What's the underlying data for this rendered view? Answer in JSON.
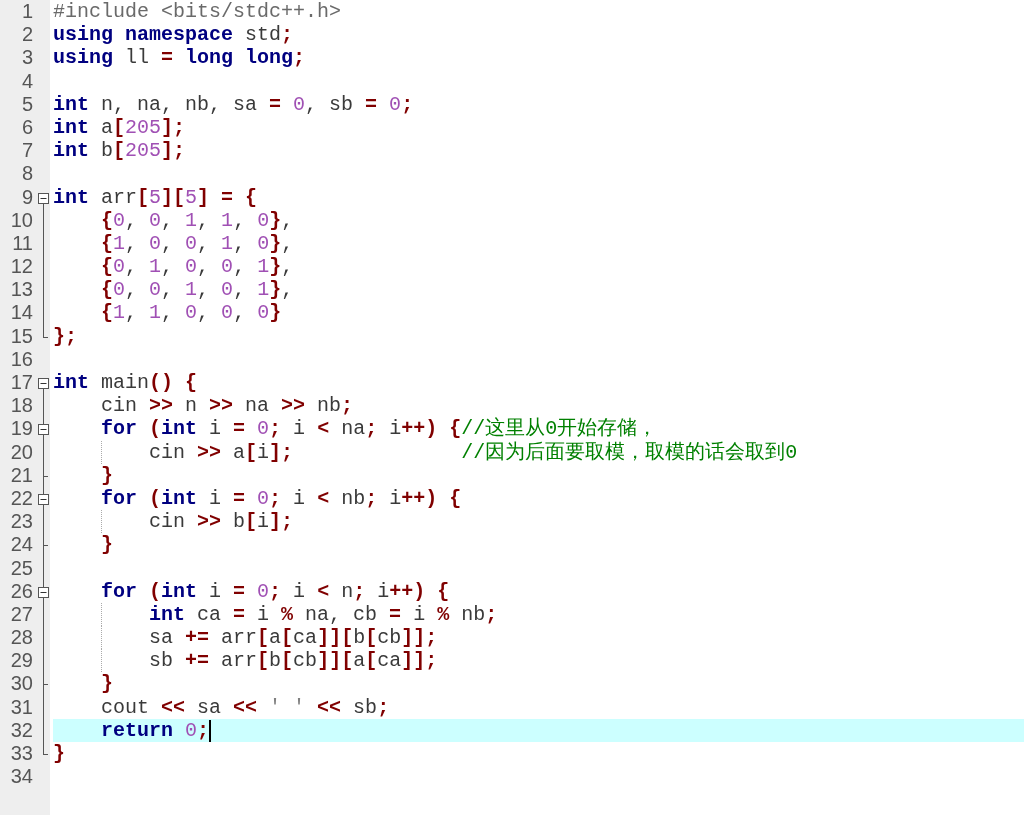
{
  "editor": {
    "lines": [
      {
        "number": "1",
        "tokens": [
          {
            "kind": "preprocessor",
            "text": "#include <bits/stdc++.h>"
          }
        ]
      },
      {
        "number": "2",
        "tokens": [
          {
            "kind": "keyword",
            "text": "using namespace"
          },
          {
            "kind": "plain",
            "text": " std"
          },
          {
            "kind": "operator",
            "text": ";"
          }
        ]
      },
      {
        "number": "3",
        "tokens": [
          {
            "kind": "keyword",
            "text": "using"
          },
          {
            "kind": "plain",
            "text": " ll "
          },
          {
            "kind": "operator",
            "text": "="
          },
          {
            "kind": "keyword",
            "text": " long long"
          },
          {
            "kind": "operator",
            "text": ";"
          }
        ]
      },
      {
        "number": "4"
      },
      {
        "number": "5",
        "tokens": [
          {
            "kind": "keyword",
            "text": "int"
          },
          {
            "kind": "plain",
            "text": " n, na, nb, sa "
          },
          {
            "kind": "operator",
            "text": "="
          },
          {
            "kind": "number",
            "text": " 0"
          },
          {
            "kind": "plain",
            "text": ", sb "
          },
          {
            "kind": "operator",
            "text": "="
          },
          {
            "kind": "number",
            "text": " 0"
          },
          {
            "kind": "operator",
            "text": ";"
          }
        ]
      },
      {
        "number": "6",
        "tokens": [
          {
            "kind": "keyword",
            "text": "int"
          },
          {
            "kind": "plain",
            "text": " a"
          },
          {
            "kind": "operator",
            "text": "["
          },
          {
            "kind": "number",
            "text": "205"
          },
          {
            "kind": "operator",
            "text": "];"
          }
        ]
      },
      {
        "number": "7",
        "tokens": [
          {
            "kind": "keyword",
            "text": "int"
          },
          {
            "kind": "plain",
            "text": " b"
          },
          {
            "kind": "operator",
            "text": "["
          },
          {
            "kind": "number",
            "text": "205"
          },
          {
            "kind": "operator",
            "text": "];"
          }
        ]
      },
      {
        "number": "8"
      },
      {
        "number": "9",
        "foldable": true,
        "tokens": [
          {
            "kind": "keyword",
            "text": "int"
          },
          {
            "kind": "plain",
            "text": " arr"
          },
          {
            "kind": "operator",
            "text": "["
          },
          {
            "kind": "number",
            "text": "5"
          },
          {
            "kind": "operator",
            "text": "]["
          },
          {
            "kind": "number",
            "text": "5"
          },
          {
            "kind": "operator",
            "text": "] = {"
          }
        ]
      },
      {
        "number": "10",
        "in_fold": true,
        "tokens": [
          {
            "kind": "operator",
            "text": "    {"
          },
          {
            "kind": "number",
            "text": "0"
          },
          {
            "kind": "plain",
            "text": ", "
          },
          {
            "kind": "number",
            "text": "0"
          },
          {
            "kind": "plain",
            "text": ", "
          },
          {
            "kind": "number",
            "text": "1"
          },
          {
            "kind": "plain",
            "text": ", "
          },
          {
            "kind": "number",
            "text": "1"
          },
          {
            "kind": "plain",
            "text": ", "
          },
          {
            "kind": "number",
            "text": "0"
          },
          {
            "kind": "operator",
            "text": "}"
          },
          {
            "kind": "plain",
            "text": ","
          }
        ]
      },
      {
        "number": "11",
        "in_fold": true,
        "tokens": [
          {
            "kind": "operator",
            "text": "    {"
          },
          {
            "kind": "number",
            "text": "1"
          },
          {
            "kind": "plain",
            "text": ", "
          },
          {
            "kind": "number",
            "text": "0"
          },
          {
            "kind": "plain",
            "text": ", "
          },
          {
            "kind": "number",
            "text": "0"
          },
          {
            "kind": "plain",
            "text": ", "
          },
          {
            "kind": "number",
            "text": "1"
          },
          {
            "kind": "plain",
            "text": ", "
          },
          {
            "kind": "number",
            "text": "0"
          },
          {
            "kind": "operator",
            "text": "}"
          },
          {
            "kind": "plain",
            "text": ","
          }
        ]
      },
      {
        "number": "12",
        "in_fold": true,
        "tokens": [
          {
            "kind": "operator",
            "text": "    {"
          },
          {
            "kind": "number",
            "text": "0"
          },
          {
            "kind": "plain",
            "text": ", "
          },
          {
            "kind": "number",
            "text": "1"
          },
          {
            "kind": "plain",
            "text": ", "
          },
          {
            "kind": "number",
            "text": "0"
          },
          {
            "kind": "plain",
            "text": ", "
          },
          {
            "kind": "number",
            "text": "0"
          },
          {
            "kind": "plain",
            "text": ", "
          },
          {
            "kind": "number",
            "text": "1"
          },
          {
            "kind": "operator",
            "text": "}"
          },
          {
            "kind": "plain",
            "text": ","
          }
        ]
      },
      {
        "number": "13",
        "in_fold": true,
        "tokens": [
          {
            "kind": "operator",
            "text": "    {"
          },
          {
            "kind": "number",
            "text": "0"
          },
          {
            "kind": "plain",
            "text": ", "
          },
          {
            "kind": "number",
            "text": "0"
          },
          {
            "kind": "plain",
            "text": ", "
          },
          {
            "kind": "number",
            "text": "1"
          },
          {
            "kind": "plain",
            "text": ", "
          },
          {
            "kind": "number",
            "text": "0"
          },
          {
            "kind": "plain",
            "text": ", "
          },
          {
            "kind": "number",
            "text": "1"
          },
          {
            "kind": "operator",
            "text": "}"
          },
          {
            "kind": "plain",
            "text": ","
          }
        ]
      },
      {
        "number": "14",
        "in_fold": true,
        "tokens": [
          {
            "kind": "operator",
            "text": "    {"
          },
          {
            "kind": "number",
            "text": "1"
          },
          {
            "kind": "plain",
            "text": ", "
          },
          {
            "kind": "number",
            "text": "1"
          },
          {
            "kind": "plain",
            "text": ", "
          },
          {
            "kind": "number",
            "text": "0"
          },
          {
            "kind": "plain",
            "text": ", "
          },
          {
            "kind": "number",
            "text": "0"
          },
          {
            "kind": "plain",
            "text": ", "
          },
          {
            "kind": "number",
            "text": "0"
          },
          {
            "kind": "operator",
            "text": "}"
          }
        ]
      },
      {
        "number": "15",
        "fold_end": true,
        "tokens": [
          {
            "kind": "operator",
            "text": "};"
          }
        ]
      },
      {
        "number": "16"
      },
      {
        "number": "17",
        "foldable": true,
        "tokens": [
          {
            "kind": "keyword",
            "text": "int"
          },
          {
            "kind": "plain",
            "text": " main"
          },
          {
            "kind": "operator",
            "text": "() {"
          }
        ]
      },
      {
        "number": "18",
        "in_fold": true,
        "tokens": [
          {
            "kind": "plain",
            "text": "    cin "
          },
          {
            "kind": "operator",
            "text": ">>"
          },
          {
            "kind": "plain",
            "text": " n "
          },
          {
            "kind": "operator",
            "text": ">>"
          },
          {
            "kind": "plain",
            "text": " na "
          },
          {
            "kind": "operator",
            "text": ">>"
          },
          {
            "kind": "plain",
            "text": " nb"
          },
          {
            "kind": "operator",
            "text": ";"
          }
        ]
      },
      {
        "number": "19",
        "foldable": true,
        "in_fold": true,
        "tokens": [
          {
            "kind": "keyword",
            "text": "    for"
          },
          {
            "kind": "operator",
            "text": " ("
          },
          {
            "kind": "keyword",
            "text": "int"
          },
          {
            "kind": "plain",
            "text": " i "
          },
          {
            "kind": "operator",
            "text": "="
          },
          {
            "kind": "number",
            "text": " 0"
          },
          {
            "kind": "operator",
            "text": ";"
          },
          {
            "kind": "plain",
            "text": " i "
          },
          {
            "kind": "operator",
            "text": "<"
          },
          {
            "kind": "plain",
            "text": " na"
          },
          {
            "kind": "operator",
            "text": ";"
          },
          {
            "kind": "plain",
            "text": " i"
          },
          {
            "kind": "operator",
            "text": "++) {"
          },
          {
            "kind": "comment",
            "text": "//这里从0开始存储，"
          }
        ]
      },
      {
        "number": "20",
        "in_fold": true,
        "guide": true,
        "tokens": [
          {
            "kind": "plain",
            "text": "        cin "
          },
          {
            "kind": "operator",
            "text": ">>"
          },
          {
            "kind": "plain",
            "text": " a"
          },
          {
            "kind": "operator",
            "text": "["
          },
          {
            "kind": "plain",
            "text": "i"
          },
          {
            "kind": "operator",
            "text": "];"
          },
          {
            "kind": "comment",
            "text": "              //因为后面要取模，取模的话会取到0"
          }
        ]
      },
      {
        "number": "21",
        "in_fold": true,
        "fold_end": true,
        "tokens": [
          {
            "kind": "operator",
            "text": "    }"
          }
        ]
      },
      {
        "number": "22",
        "foldable": true,
        "in_fold": true,
        "tokens": [
          {
            "kind": "keyword",
            "text": "    for"
          },
          {
            "kind": "operator",
            "text": " ("
          },
          {
            "kind": "keyword",
            "text": "int"
          },
          {
            "kind": "plain",
            "text": " i "
          },
          {
            "kind": "operator",
            "text": "="
          },
          {
            "kind": "number",
            "text": " 0"
          },
          {
            "kind": "operator",
            "text": ";"
          },
          {
            "kind": "plain",
            "text": " i "
          },
          {
            "kind": "operator",
            "text": "<"
          },
          {
            "kind": "plain",
            "text": " nb"
          },
          {
            "kind": "operator",
            "text": ";"
          },
          {
            "kind": "plain",
            "text": " i"
          },
          {
            "kind": "operator",
            "text": "++) {"
          }
        ]
      },
      {
        "number": "23",
        "in_fold": true,
        "guide": true,
        "tokens": [
          {
            "kind": "plain",
            "text": "        cin "
          },
          {
            "kind": "operator",
            "text": ">>"
          },
          {
            "kind": "plain",
            "text": " b"
          },
          {
            "kind": "operator",
            "text": "["
          },
          {
            "kind": "plain",
            "text": "i"
          },
          {
            "kind": "operator",
            "text": "];"
          }
        ]
      },
      {
        "number": "24",
        "in_fold": true,
        "fold_end": true,
        "tokens": [
          {
            "kind": "operator",
            "text": "    }"
          }
        ]
      },
      {
        "number": "25",
        "in_fold": true
      },
      {
        "number": "26",
        "foldable": true,
        "in_fold": true,
        "tokens": [
          {
            "kind": "keyword",
            "text": "    for"
          },
          {
            "kind": "operator",
            "text": " ("
          },
          {
            "kind": "keyword",
            "text": "int"
          },
          {
            "kind": "plain",
            "text": " i "
          },
          {
            "kind": "operator",
            "text": "="
          },
          {
            "kind": "number",
            "text": " 0"
          },
          {
            "kind": "operator",
            "text": ";"
          },
          {
            "kind": "plain",
            "text": " i "
          },
          {
            "kind": "operator",
            "text": "<"
          },
          {
            "kind": "plain",
            "text": " n"
          },
          {
            "kind": "operator",
            "text": ";"
          },
          {
            "kind": "plain",
            "text": " i"
          },
          {
            "kind": "operator",
            "text": "++) {"
          }
        ]
      },
      {
        "number": "27",
        "in_fold": true,
        "guide": true,
        "tokens": [
          {
            "kind": "keyword",
            "text": "        int"
          },
          {
            "kind": "plain",
            "text": " ca "
          },
          {
            "kind": "operator",
            "text": "="
          },
          {
            "kind": "plain",
            "text": " i "
          },
          {
            "kind": "operator",
            "text": "%"
          },
          {
            "kind": "plain",
            "text": " na, cb "
          },
          {
            "kind": "operator",
            "text": "="
          },
          {
            "kind": "plain",
            "text": " i "
          },
          {
            "kind": "operator",
            "text": "%"
          },
          {
            "kind": "plain",
            "text": " nb"
          },
          {
            "kind": "operator",
            "text": ";"
          }
        ]
      },
      {
        "number": "28",
        "in_fold": true,
        "guide": true,
        "tokens": [
          {
            "kind": "plain",
            "text": "        sa "
          },
          {
            "kind": "operator",
            "text": "+="
          },
          {
            "kind": "plain",
            "text": " arr"
          },
          {
            "kind": "operator",
            "text": "["
          },
          {
            "kind": "plain",
            "text": "a"
          },
          {
            "kind": "operator",
            "text": "["
          },
          {
            "kind": "plain",
            "text": "ca"
          },
          {
            "kind": "operator",
            "text": "]]["
          },
          {
            "kind": "plain",
            "text": "b"
          },
          {
            "kind": "operator",
            "text": "["
          },
          {
            "kind": "plain",
            "text": "cb"
          },
          {
            "kind": "operator",
            "text": "]];"
          }
        ]
      },
      {
        "number": "29",
        "in_fold": true,
        "guide": true,
        "tokens": [
          {
            "kind": "plain",
            "text": "        sb "
          },
          {
            "kind": "operator",
            "text": "+="
          },
          {
            "kind": "plain",
            "text": " arr"
          },
          {
            "kind": "operator",
            "text": "["
          },
          {
            "kind": "plain",
            "text": "b"
          },
          {
            "kind": "operator",
            "text": "["
          },
          {
            "kind": "plain",
            "text": "cb"
          },
          {
            "kind": "operator",
            "text": "]]["
          },
          {
            "kind": "plain",
            "text": "a"
          },
          {
            "kind": "operator",
            "text": "["
          },
          {
            "kind": "plain",
            "text": "ca"
          },
          {
            "kind": "operator",
            "text": "]];"
          }
        ]
      },
      {
        "number": "30",
        "in_fold": true,
        "fold_end": true,
        "tokens": [
          {
            "kind": "operator",
            "text": "    }"
          }
        ]
      },
      {
        "number": "31",
        "in_fold": true,
        "tokens": [
          {
            "kind": "plain",
            "text": "    cout "
          },
          {
            "kind": "operator",
            "text": "<<"
          },
          {
            "kind": "plain",
            "text": " sa "
          },
          {
            "kind": "operator",
            "text": "<<"
          },
          {
            "kind": "string",
            "text": " ' ' "
          },
          {
            "kind": "operator",
            "text": "<<"
          },
          {
            "kind": "plain",
            "text": " sb"
          },
          {
            "kind": "operator",
            "text": ";"
          }
        ]
      },
      {
        "number": "32",
        "in_fold": true,
        "current": true,
        "tokens": [
          {
            "kind": "keyword",
            "text": "    return"
          },
          {
            "kind": "number",
            "text": " 0"
          },
          {
            "kind": "operator",
            "text": ";"
          }
        ]
      },
      {
        "number": "33",
        "fold_end": true,
        "tokens": [
          {
            "kind": "operator",
            "text": "}"
          }
        ]
      },
      {
        "number": "34"
      }
    ]
  }
}
